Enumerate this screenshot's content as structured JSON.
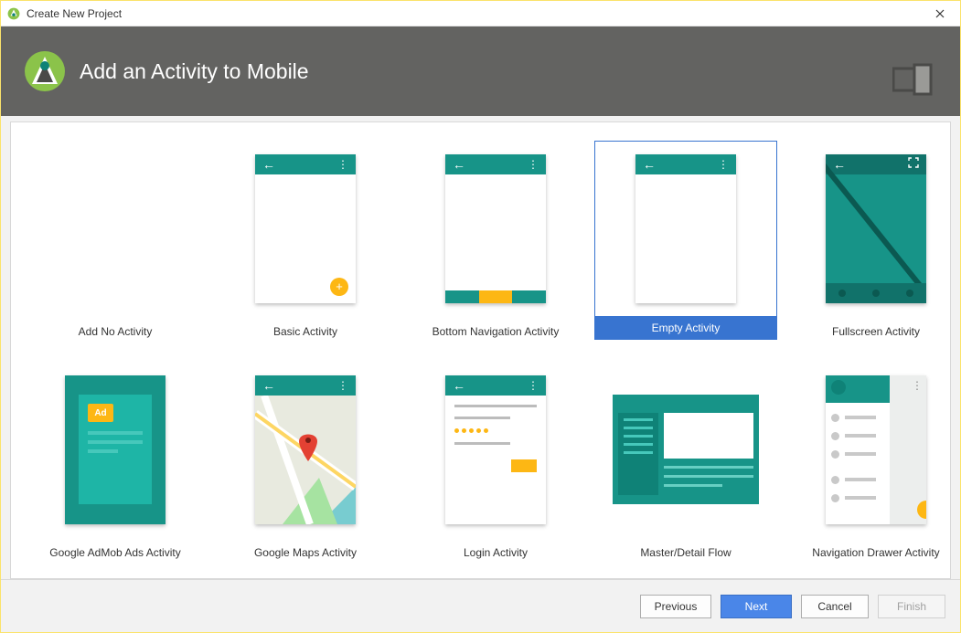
{
  "window": {
    "title": "Create New Project"
  },
  "header": {
    "title": "Add an Activity to Mobile"
  },
  "templates": [
    {
      "label": "Add No Activity",
      "kind": "none",
      "selected": false
    },
    {
      "label": "Basic Activity",
      "kind": "basic",
      "selected": false
    },
    {
      "label": "Bottom Navigation Activity",
      "kind": "bottomnav",
      "selected": false
    },
    {
      "label": "Empty Activity",
      "kind": "empty",
      "selected": true
    },
    {
      "label": "Fullscreen Activity",
      "kind": "fullscreen",
      "selected": false
    },
    {
      "label": "Google AdMob Ads Activity",
      "kind": "admob",
      "selected": false
    },
    {
      "label": "Google Maps Activity",
      "kind": "maps",
      "selected": false
    },
    {
      "label": "Login Activity",
      "kind": "login",
      "selected": false
    },
    {
      "label": "Master/Detail Flow",
      "kind": "masterdetail",
      "selected": false
    },
    {
      "label": "Navigation Drawer Activity",
      "kind": "navdrawer",
      "selected": false
    }
  ],
  "buttons": {
    "previous": "Previous",
    "next": "Next",
    "cancel": "Cancel",
    "finish": "Finish"
  },
  "ad_badge_text": "Ad",
  "colors": {
    "accent_teal": "#179488",
    "accent_amber": "#fdb714",
    "selection_blue": "#3874d0",
    "header_gray": "#636361"
  }
}
